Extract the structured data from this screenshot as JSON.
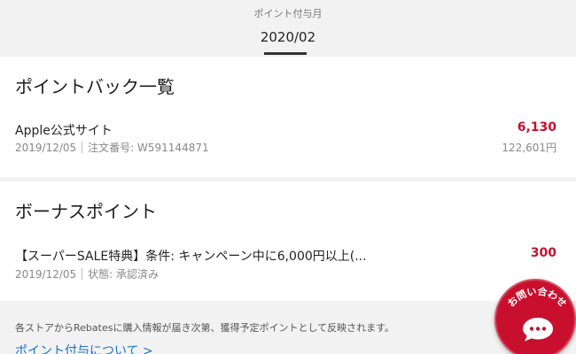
{
  "header": {
    "month_label": "ポイント付与月",
    "month_value": "2020/02"
  },
  "pointback": {
    "title": "ポイントバック一覧",
    "items": [
      {
        "name": "Apple公式サイト",
        "date": "2019/12/05",
        "detail": "注文番号: W591144871",
        "points": "6,130",
        "amount": "122,601円"
      }
    ]
  },
  "bonus": {
    "title": "ボーナスポイント",
    "items": [
      {
        "name": "【スーパーSALE特典】条件: キャンペーン中に6,000円以上(...",
        "date": "2019/12/05",
        "detail": "状態: 承認済み",
        "points": "300"
      }
    ]
  },
  "footer": {
    "notice": "各ストアからRebatesに購入情報が届き次第、獲得予定ポイントとして反映されます。",
    "link": "ポイント付与について >"
  },
  "contact_button": {
    "label": "お問い合わせ"
  },
  "colors": {
    "accent_red": "#c8102e",
    "link_blue": "#1a73c8"
  }
}
